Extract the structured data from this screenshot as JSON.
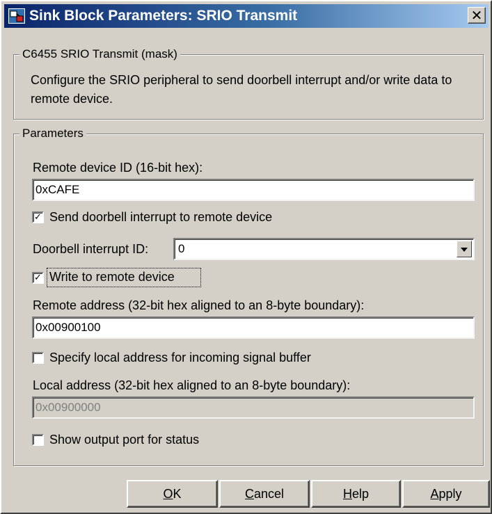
{
  "window": {
    "title": "Sink Block Parameters: SRIO Transmit",
    "icon": "simulink-block-icon",
    "close_glyph": "✕"
  },
  "mask_group": {
    "legend": "C6455 SRIO Transmit (mask)",
    "description": "Configure the SRIO peripheral to send doorbell interrupt and/or write data to remote device."
  },
  "params_group": {
    "legend": "Parameters",
    "remote_id_label": "Remote device ID (16-bit hex):",
    "remote_id_value": "0xCAFE",
    "send_doorbell_label": "Send doorbell interrupt to remote device",
    "send_doorbell_checked": true,
    "doorbell_id_label": "Doorbell interrupt ID:",
    "doorbell_id_value": "0",
    "write_remote_label": "Write to remote device",
    "write_remote_checked": true,
    "remote_address_label": "Remote address (32-bit hex aligned to an 8-byte boundary):",
    "remote_address_value": "0x00900100",
    "specify_local_label": "Specify local address for incoming signal buffer",
    "specify_local_checked": false,
    "local_address_label": "Local address (32-bit hex aligned to an 8-byte boundary):",
    "local_address_value": "0x00900000",
    "show_status_label": "Show output port for status",
    "show_status_checked": false
  },
  "buttons": {
    "ok": {
      "mnemonic": "O",
      "rest": "K"
    },
    "cancel": {
      "mnemonic": "C",
      "rest": "ancel"
    },
    "help": {
      "mnemonic": "H",
      "rest": "elp"
    },
    "apply": {
      "mnemonic": "A",
      "rest": "pply"
    }
  }
}
